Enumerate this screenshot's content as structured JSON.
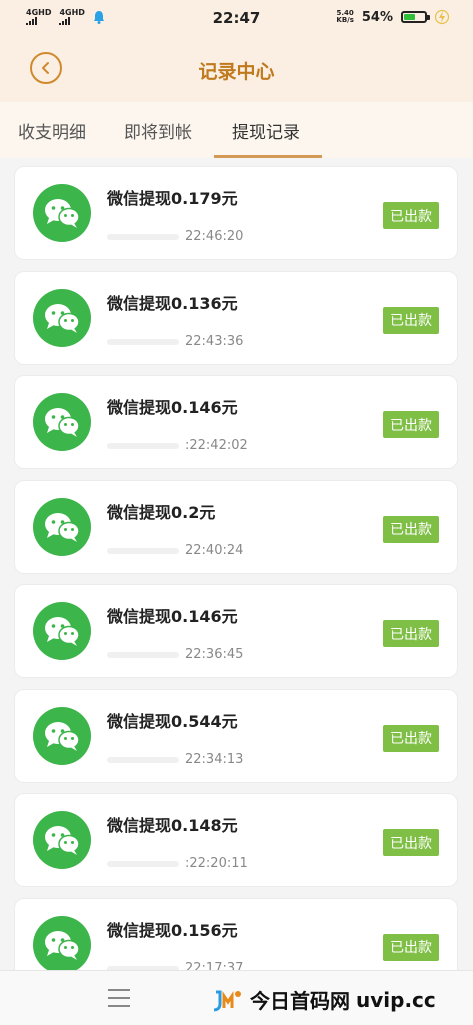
{
  "status_bar": {
    "network1": "4GHD",
    "network2": "4GHD",
    "time": "22:47",
    "net_speed_value": "5.40",
    "net_speed_unit": "KB/s",
    "battery_percent": "54%",
    "battery_level": 0.54
  },
  "header": {
    "title": "记录中心"
  },
  "tabs": [
    {
      "label": "收支明细"
    },
    {
      "label": "即将到帐"
    },
    {
      "label": "提现记录"
    }
  ],
  "records": [
    {
      "title": "微信提现0.179元",
      "time": "22:46:20",
      "status": "已出款"
    },
    {
      "title": "微信提现0.136元",
      "time": "22:43:36",
      "status": "已出款"
    },
    {
      "title": "微信提现0.146元",
      "time": ":22:42:02",
      "status": "已出款"
    },
    {
      "title": "微信提现0.2元",
      "time": "22:40:24",
      "status": "已出款"
    },
    {
      "title": "微信提现0.146元",
      "time": "22:36:45",
      "status": "已出款"
    },
    {
      "title": "微信提现0.544元",
      "time": "22:34:13",
      "status": "已出款"
    },
    {
      "title": "微信提现0.148元",
      "time": ":22:20:11",
      "status": "已出款"
    },
    {
      "title": "微信提现0.156元",
      "time": "22:17:37",
      "status": "已出款"
    }
  ],
  "watermark": {
    "text": "今日首码网",
    "url": "uvip.cc"
  },
  "colors": {
    "accent": "#c07a1e",
    "wechat_green": "#3cb54a",
    "status_green": "#7fbf45"
  }
}
